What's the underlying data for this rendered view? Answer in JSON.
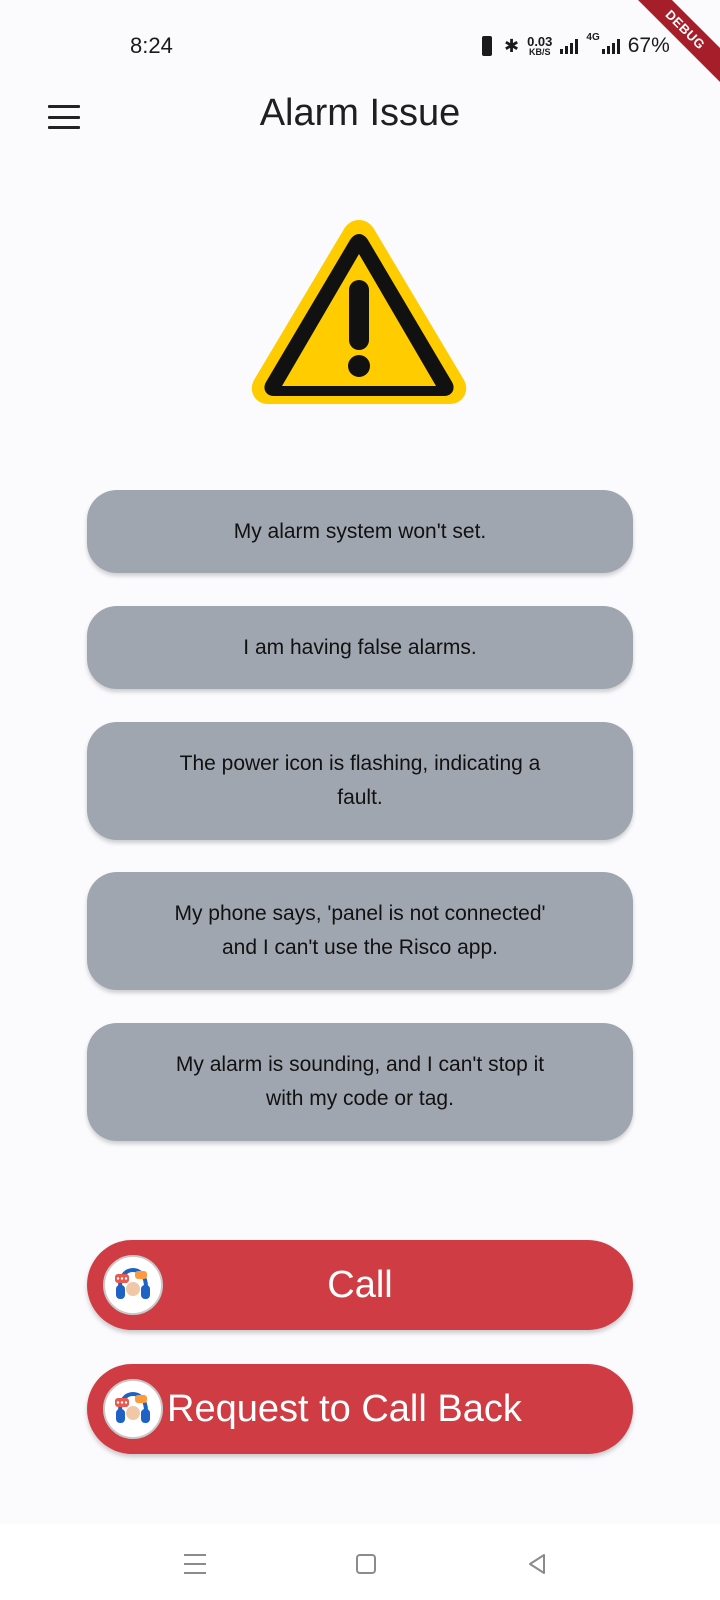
{
  "status_bar": {
    "time": "8:24",
    "net_speed_value": "0.03",
    "net_speed_unit": "KB/S",
    "network_type": "4G",
    "battery": "67%",
    "icons": [
      "vibrate-icon",
      "bluetooth-icon",
      "signal-icon",
      "signal-4g-icon"
    ]
  },
  "debug_banner": "DEBUG",
  "app_bar": {
    "menu_icon": "hamburger-menu-icon",
    "title": "Alarm Issue"
  },
  "hero_icon": "warning-triangle-icon",
  "issues": [
    {
      "label": "My alarm system won't set."
    },
    {
      "label": "I am having false alarms."
    },
    {
      "label": "The power icon is flashing, indicating a fault."
    },
    {
      "label": "My phone says, 'panel is not connected' and I can't use the Risco app."
    },
    {
      "label": "My alarm is sounding, and I can't stop it with my code or tag."
    }
  ],
  "actions": {
    "call_label": "Call",
    "callback_label": "Request to Call Back",
    "avatar_icon": "customer-support-headset-icon"
  },
  "nav_bar": {
    "icons": [
      "recents-icon",
      "home-icon",
      "back-icon"
    ]
  },
  "colors": {
    "background": "#fbfbfe",
    "issue_button": "#a0a6b0",
    "action_button": "#d03c43",
    "warning_fill": "#ffcc00",
    "debug_ribbon": "#a61e2a"
  }
}
